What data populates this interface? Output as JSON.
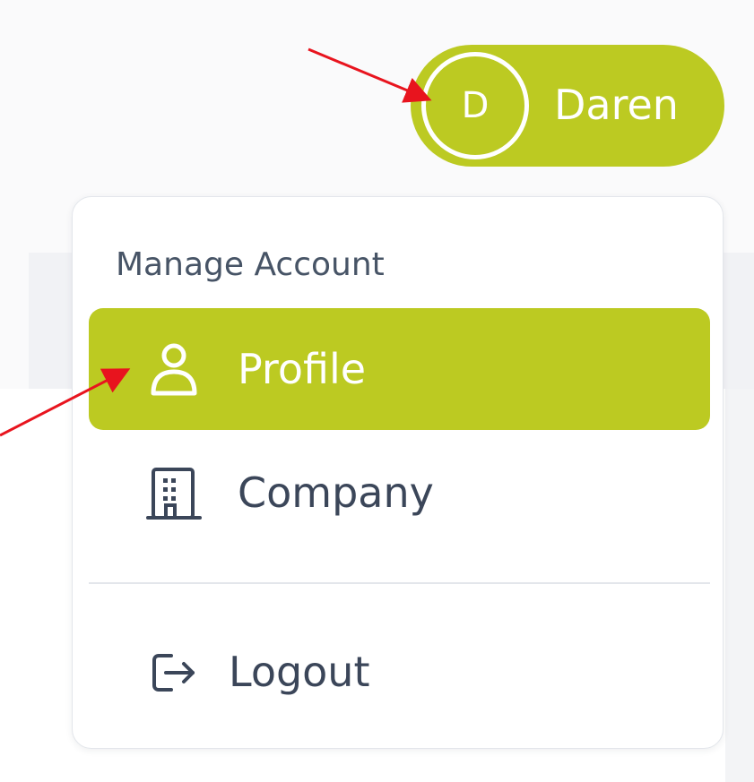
{
  "header": {
    "user": {
      "initial": "D",
      "name": "Daren"
    }
  },
  "menu": {
    "heading": "Manage Account",
    "items": [
      {
        "label": "Profile",
        "icon": "user-icon",
        "active": true
      },
      {
        "label": "Company",
        "icon": "building-icon",
        "active": false
      },
      {
        "label": "Logout",
        "icon": "logout-icon",
        "active": false
      }
    ]
  },
  "colors": {
    "accent": "#bcca22",
    "text": "#3b4659",
    "heading": "#475466",
    "annotation_arrow": "#e8141e"
  }
}
